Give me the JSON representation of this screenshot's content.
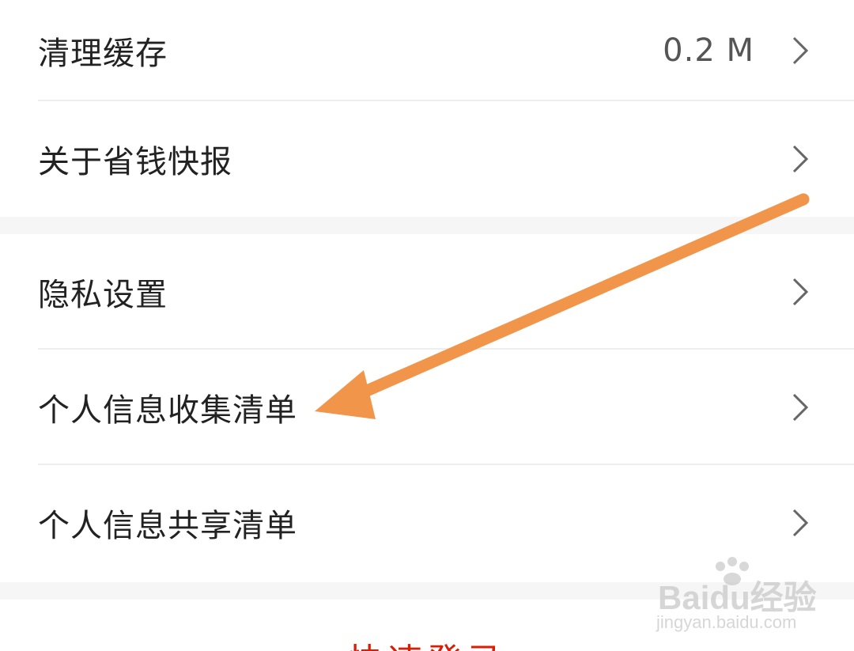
{
  "settings_group_1": {
    "items": [
      {
        "label": "清理缓存",
        "value": "0.2 M"
      },
      {
        "label": "关于省钱快报"
      }
    ]
  },
  "settings_group_2": {
    "items": [
      {
        "label": "隐私设置"
      },
      {
        "label": "个人信息收集清单"
      },
      {
        "label": "个人信息共享清单"
      }
    ]
  },
  "login_button": {
    "label": "快速登录"
  },
  "annotation": {
    "arrow_color": "#f0954a",
    "points_to": "个人信息收集清单"
  },
  "watermark": {
    "brand": "Baidu经验",
    "url": "jingyan.baidu.com"
  },
  "colors": {
    "accent_red": "#d81e06",
    "chevron": "#666666",
    "text": "#222222"
  }
}
